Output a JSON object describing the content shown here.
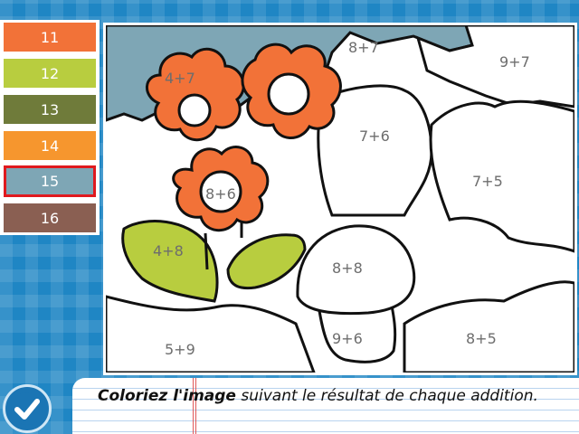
{
  "palette": [
    {
      "label": "11",
      "color": "#f27238"
    },
    {
      "label": "12",
      "color": "#b8cd3f"
    },
    {
      "label": "13",
      "color": "#6f7b3a"
    },
    {
      "label": "14",
      "color": "#f6962e"
    },
    {
      "label": "15",
      "color": "#7ea6b5",
      "selected": true
    },
    {
      "label": "16",
      "color": "#8a5f52"
    }
  ],
  "selected_color": "15",
  "canvas": {
    "labels": {
      "sky_top": "8+7",
      "sky_right": "9+7",
      "flower_left": "4+7",
      "flower_center": "8+6",
      "leaf_top": "7+6",
      "bush_right": "7+5",
      "leaf_green": "4+8",
      "mushroom_cap": "8+8",
      "ground_left": "5+9",
      "mushroom_stem": "9+6",
      "ground_right": "8+5"
    },
    "colors": {
      "sky": "#7ea6b5",
      "flower": "#f27238",
      "leaf": "#b8cd3f"
    }
  },
  "instruction": {
    "bold": "Coloriez l'image",
    "rest": " suivant le résultat de chaque addition."
  },
  "validate_icon": "checkmark-icon"
}
